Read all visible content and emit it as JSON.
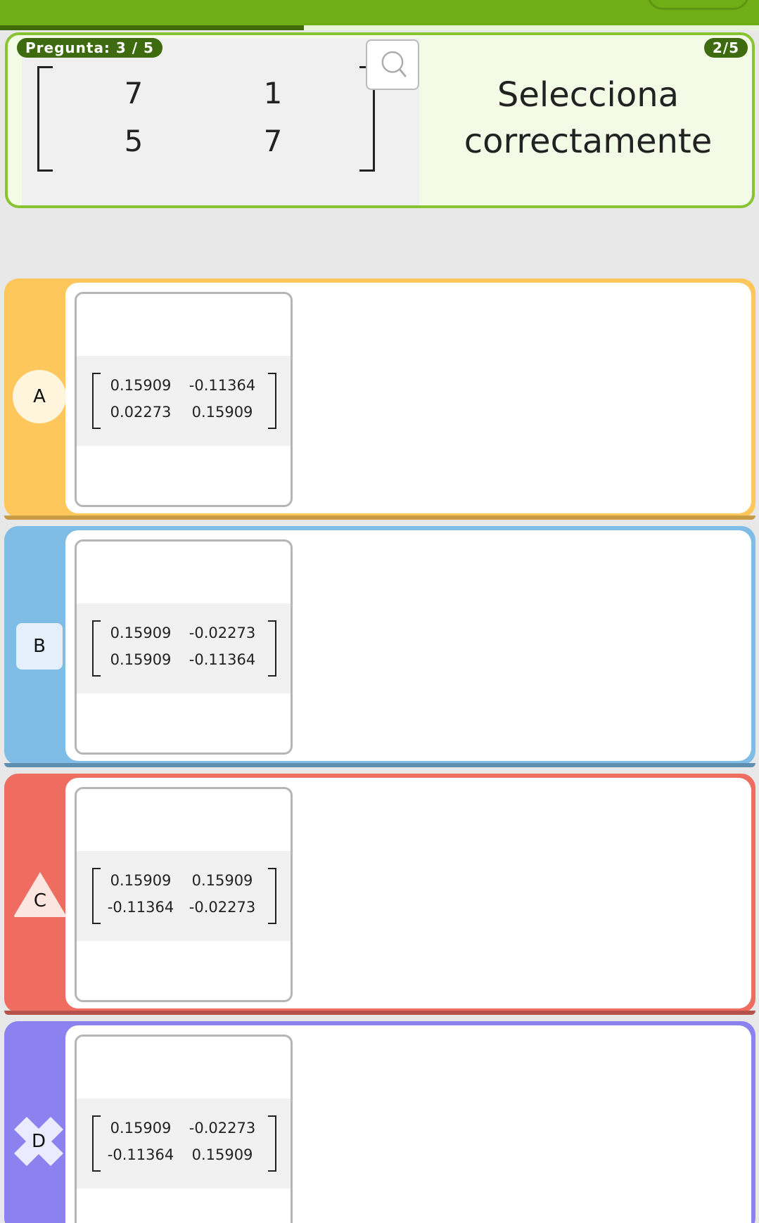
{
  "question": {
    "label": "Pregunta: 3 / 5",
    "score": "2/5",
    "prompt": "Selecciona correctamente",
    "matrix": [
      [
        "7",
        "1"
      ],
      [
        "5",
        "7"
      ]
    ],
    "progress_fraction": 0.4
  },
  "options": [
    {
      "letter": "A",
      "color": "#fdc75b",
      "shape": "circle",
      "matrix": [
        [
          "0.15909",
          "-0.11364"
        ],
        [
          "0.02273",
          "0.15909"
        ]
      ]
    },
    {
      "letter": "B",
      "color": "#7fbde6",
      "shape": "square",
      "matrix": [
        [
          "0.15909",
          "-0.02273"
        ],
        [
          "0.15909",
          "-0.11364"
        ]
      ]
    },
    {
      "letter": "C",
      "color": "#ee6c60",
      "shape": "triangle",
      "matrix": [
        [
          "0.15909",
          "0.15909"
        ],
        [
          "-0.11364",
          "-0.02273"
        ]
      ]
    },
    {
      "letter": "D",
      "color": "#8b82f0",
      "shape": "cross",
      "matrix": [
        [
          "0.15909",
          "-0.02273"
        ],
        [
          "-0.11364",
          "0.15909"
        ]
      ]
    }
  ],
  "icons": {
    "zoom": "magnifier-icon"
  },
  "colors": {
    "header": "#6fae17",
    "badge": "#3e6a10",
    "question_border": "#88c332"
  }
}
